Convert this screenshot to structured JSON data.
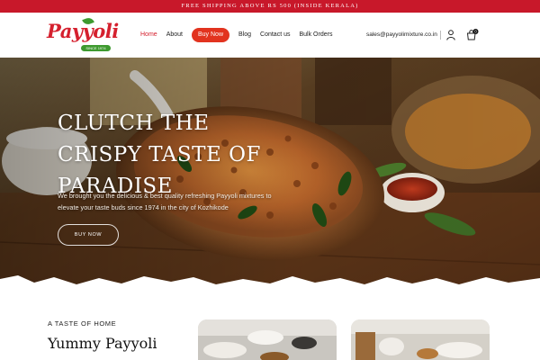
{
  "promo": {
    "text": "FREE SHIPPING ABOVE RS 500 (INSIDE KERALA)"
  },
  "brand": {
    "logo_text": "Payyoli",
    "tagline": "SINCE 1974"
  },
  "nav": {
    "items": [
      "Home",
      "About",
      "Buy Now",
      "Blog",
      "Contact us",
      "Bulk Orders"
    ],
    "active": "Home"
  },
  "header": {
    "email": "sales@payyolimixture.co.in",
    "cart_count": "0"
  },
  "hero": {
    "title": "CLUTCH THE CRISPY TASTE OF PARADISE",
    "subtitle": "We brought you the delicious & best quality refreshing Payyoli mixtures to elevate your taste buds since 1974 in the city of Kozhikode",
    "button": "BUY NOW"
  },
  "section": {
    "tag": "A TASTE OF HOME",
    "heading": "Yummy Payyoli"
  },
  "colors": {
    "brand_red": "#d5202e",
    "button_orange": "#e2331f",
    "leaf_green": "#3e9a2f"
  }
}
